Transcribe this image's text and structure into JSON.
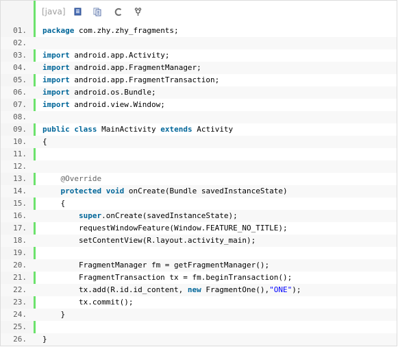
{
  "toolbar": {
    "language_label": "[java]",
    "icons": [
      "view-source-icon",
      "copy-icon",
      "refresh-icon",
      "fork-icon"
    ]
  },
  "colors": {
    "keyword": "#006699",
    "annotation": "#646464",
    "string": "#0000ff",
    "gutter_bar": "#6ce26c",
    "line_number": "#5c5c5c"
  },
  "lines": [
    {
      "num": "01.",
      "tokens": [
        {
          "t": "package",
          "c": "kw"
        },
        {
          "t": " com.zhy.zhy_fragments;"
        }
      ]
    },
    {
      "num": "02.",
      "tokens": []
    },
    {
      "num": "03.",
      "tokens": [
        {
          "t": "import",
          "c": "kw"
        },
        {
          "t": " android.app.Activity;"
        }
      ]
    },
    {
      "num": "04.",
      "tokens": [
        {
          "t": "import",
          "c": "kw"
        },
        {
          "t": " android.app.FragmentManager;"
        }
      ]
    },
    {
      "num": "05.",
      "tokens": [
        {
          "t": "import",
          "c": "kw"
        },
        {
          "t": " android.app.FragmentTransaction;"
        }
      ]
    },
    {
      "num": "06.",
      "tokens": [
        {
          "t": "import",
          "c": "kw"
        },
        {
          "t": " android.os.Bundle;"
        }
      ]
    },
    {
      "num": "07.",
      "tokens": [
        {
          "t": "import",
          "c": "kw"
        },
        {
          "t": " android.view.Window;"
        }
      ]
    },
    {
      "num": "08.",
      "tokens": []
    },
    {
      "num": "09.",
      "tokens": [
        {
          "t": "public",
          "c": "kw"
        },
        {
          "t": " "
        },
        {
          "t": "class",
          "c": "kw"
        },
        {
          "t": " MainActivity "
        },
        {
          "t": "extends",
          "c": "kw"
        },
        {
          "t": " Activity"
        }
      ]
    },
    {
      "num": "10.",
      "tokens": [
        {
          "t": "{"
        }
      ]
    },
    {
      "num": "11.",
      "tokens": []
    },
    {
      "num": "12.",
      "tokens": []
    },
    {
      "num": "13.",
      "tokens": [
        {
          "t": "    "
        },
        {
          "t": "@Override",
          "c": "ann"
        }
      ]
    },
    {
      "num": "14.",
      "tokens": [
        {
          "t": "    "
        },
        {
          "t": "protected",
          "c": "kw"
        },
        {
          "t": " "
        },
        {
          "t": "void",
          "c": "kw"
        },
        {
          "t": " onCreate(Bundle savedInstanceState)"
        }
      ]
    },
    {
      "num": "15.",
      "tokens": [
        {
          "t": "    {"
        }
      ]
    },
    {
      "num": "16.",
      "tokens": [
        {
          "t": "        "
        },
        {
          "t": "super",
          "c": "kw"
        },
        {
          "t": ".onCreate(savedInstanceState);"
        }
      ]
    },
    {
      "num": "17.",
      "tokens": [
        {
          "t": "        requestWindowFeature(Window.FEATURE_NO_TITLE);"
        }
      ]
    },
    {
      "num": "18.",
      "tokens": [
        {
          "t": "        setContentView(R.layout.activity_main);"
        }
      ]
    },
    {
      "num": "19.",
      "tokens": []
    },
    {
      "num": "20.",
      "tokens": [
        {
          "t": "        FragmentManager fm = getFragmentManager();"
        }
      ]
    },
    {
      "num": "21.",
      "tokens": [
        {
          "t": "        FragmentTransaction tx = fm.beginTransaction();"
        }
      ]
    },
    {
      "num": "22.",
      "tokens": [
        {
          "t": "        tx.add(R.id.id_content, "
        },
        {
          "t": "new",
          "c": "kw"
        },
        {
          "t": " FragmentOne(),"
        },
        {
          "t": "\"ONE\"",
          "c": "str"
        },
        {
          "t": ");"
        }
      ]
    },
    {
      "num": "23.",
      "tokens": [
        {
          "t": "        tx.commit();"
        }
      ]
    },
    {
      "num": "24.",
      "tokens": [
        {
          "t": "    }"
        }
      ]
    },
    {
      "num": "25.",
      "tokens": []
    },
    {
      "num": "26.",
      "tokens": [
        {
          "t": "}"
        }
      ]
    }
  ]
}
